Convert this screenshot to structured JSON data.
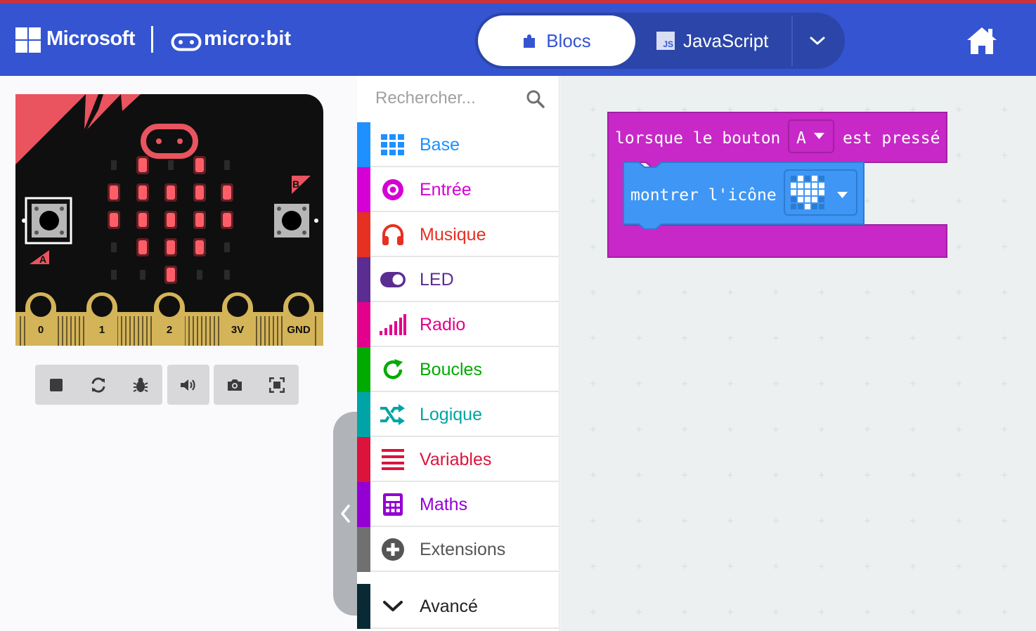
{
  "header": {
    "brand": "Microsoft",
    "product": "micro:bit",
    "tabs": [
      {
        "label": "Blocs",
        "active": true
      },
      {
        "label": "JavaScript",
        "active": false
      }
    ],
    "js_badge": "JS",
    "colors": {
      "header_bg": "#3454d1",
      "tab_active_bg": "#ffffff"
    }
  },
  "simulator": {
    "pins": [
      "0",
      "1",
      "2",
      "3V",
      "GND"
    ],
    "button_a": "A",
    "button_b": "B",
    "led_matrix": [
      [
        0,
        1,
        0,
        1,
        0
      ],
      [
        1,
        1,
        1,
        1,
        1
      ],
      [
        1,
        1,
        1,
        1,
        1
      ],
      [
        0,
        1,
        1,
        1,
        0
      ],
      [
        0,
        0,
        1,
        0,
        0
      ]
    ],
    "controls": [
      "stop-icon",
      "restart-icon",
      "debug-icon",
      "sound-icon",
      "screenshot-icon",
      "fullscreen-icon"
    ]
  },
  "toolbox": {
    "search_placeholder": "Rechercher...",
    "categories": [
      {
        "label": "Base",
        "color": "#1e90ff",
        "icon": "grid-icon"
      },
      {
        "label": "Entrée",
        "color": "#d400d4",
        "icon": "radio-button-icon"
      },
      {
        "label": "Musique",
        "color": "#e63022",
        "icon": "headphones-icon"
      },
      {
        "label": "LED",
        "color": "#5c2d91",
        "icon": "toggle-icon"
      },
      {
        "label": "Radio",
        "color": "#e3008c",
        "icon": "signal-bars-icon"
      },
      {
        "label": "Boucles",
        "color": "#00aa00",
        "icon": "refresh-icon"
      },
      {
        "label": "Logique",
        "color": "#00a4a6",
        "icon": "shuffle-icon"
      },
      {
        "label": "Variables",
        "color": "#dc143c",
        "icon": "list-icon"
      },
      {
        "label": "Maths",
        "color": "#9400d3",
        "icon": "calculator-icon"
      },
      {
        "label": "Extensions",
        "color": "#707070",
        "icon": "plus-circle-icon"
      }
    ],
    "advanced": {
      "label": "Avancé",
      "color": "#092a35",
      "icon": "chevron-down-icon"
    }
  },
  "workspace": {
    "event_block": {
      "prefix": "lorsque le bouton",
      "button": "A",
      "suffix": "est pressé",
      "color": "#c728c7"
    },
    "statement_block": {
      "label": "montrer l'icône",
      "icon": "heart",
      "color": "#3f96f4"
    }
  }
}
